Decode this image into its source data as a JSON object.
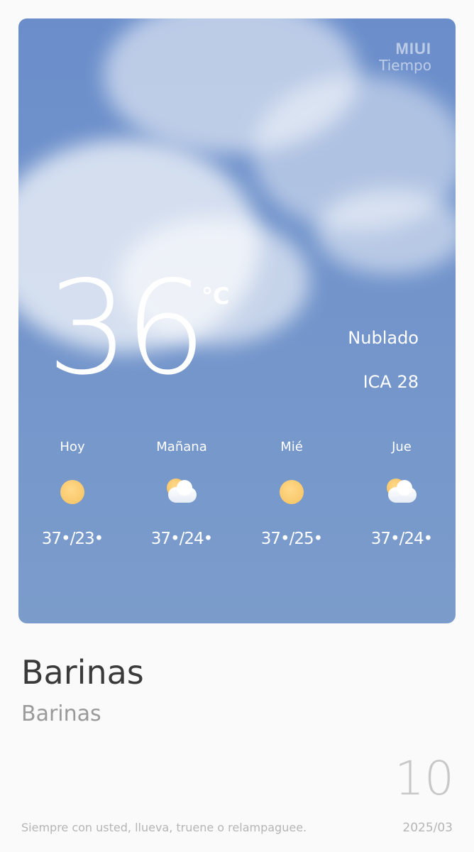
{
  "brand": {
    "line1": "MIUI",
    "line2": "Tiempo"
  },
  "current": {
    "temperature": "36",
    "unit": "°C",
    "condition": "Nublado",
    "aqi": "ICA 28"
  },
  "forecast": [
    {
      "day": "Hoy",
      "icon": "sun-icon",
      "range": "37•/23•"
    },
    {
      "day": "Mañana",
      "icon": "partly-cloudy-icon",
      "range": "37•/24•"
    },
    {
      "day": "Mié",
      "icon": "sun-icon",
      "range": "37•/25•"
    },
    {
      "day": "Jue",
      "icon": "partly-cloudy-icon",
      "range": "37•/24•"
    }
  ],
  "location": {
    "title": "Barinas",
    "subtitle": "Barinas"
  },
  "date": {
    "day": "10",
    "month_year": "2025/03"
  },
  "footer": {
    "tagline": "Siempre con usted, llueva, truene o relampaguee."
  },
  "colors": {
    "sky_top": "#6b8ecb",
    "sky_bottom": "#7b9ccb",
    "sun": "#f7c25f"
  }
}
